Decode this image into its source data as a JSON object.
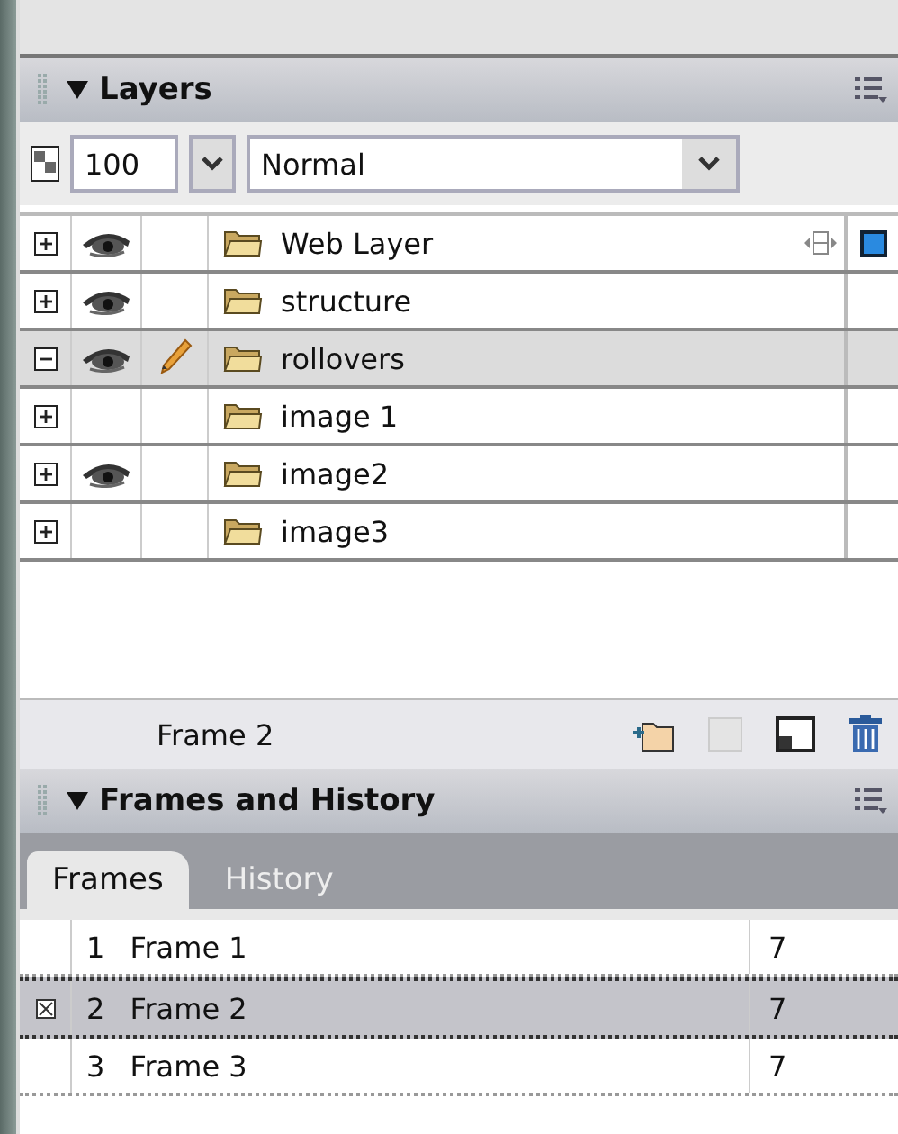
{
  "layers_panel": {
    "title": "Layers",
    "opacity": "100",
    "blend_mode": "Normal",
    "layers": [
      {
        "name": "Web Layer",
        "kind": "web",
        "expanded": false,
        "visible": true,
        "editing": false,
        "selected": false
      },
      {
        "name": "structure",
        "kind": "folder",
        "expanded": false,
        "visible": true,
        "editing": false,
        "selected": false
      },
      {
        "name": "rollovers",
        "kind": "folder",
        "expanded": true,
        "visible": true,
        "editing": true,
        "selected": true
      },
      {
        "name": "image 1",
        "kind": "folder",
        "expanded": false,
        "visible": false,
        "editing": false,
        "selected": false
      },
      {
        "name": "image2",
        "kind": "folder",
        "expanded": false,
        "visible": true,
        "editing": false,
        "selected": false
      },
      {
        "name": "image3",
        "kind": "folder",
        "expanded": false,
        "visible": false,
        "editing": false,
        "selected": false
      }
    ],
    "current_frame": "Frame 2"
  },
  "frames_panel": {
    "title": "Frames and History",
    "tabs": [
      {
        "label": "Frames",
        "selected": true
      },
      {
        "label": "History",
        "selected": false
      }
    ],
    "frames": [
      {
        "number": "1",
        "name": "Frame 1",
        "delay": "7",
        "selected": false
      },
      {
        "number": "2",
        "name": "Frame 2",
        "delay": "7",
        "selected": true
      },
      {
        "number": "3",
        "name": "Frame 3",
        "delay": "7",
        "selected": false
      }
    ]
  }
}
